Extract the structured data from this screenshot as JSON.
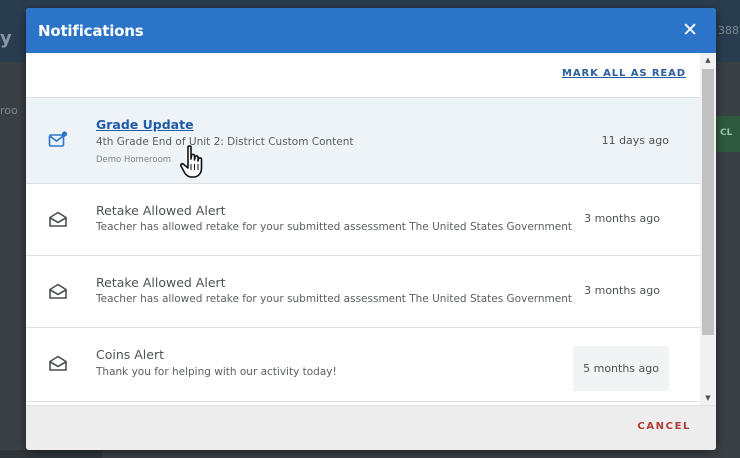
{
  "background": {
    "left_fragment": "y",
    "right_fragment": "388",
    "left_tab_fragment": "roo",
    "right_button_fragment": "CL"
  },
  "modal": {
    "title": "Notifications",
    "close_icon": "close-icon",
    "mark_all_label": "MARK ALL AS READ",
    "cancel_label": "CANCEL",
    "colors": {
      "header": "#2b74c7",
      "link": "#2b5e9c",
      "cancel": "#b23a32",
      "unread_bg": "#eef3f8"
    }
  },
  "notifications": [
    {
      "icon": "envelope-unread-icon",
      "title": "Grade Update",
      "message": "4th Grade End of Unit 2: District Custom Content",
      "subtitle": "Demo Homeroom",
      "time": "11 days ago",
      "unread": true
    },
    {
      "icon": "envelope-open-icon",
      "title": "Retake Allowed Alert",
      "message": "Teacher has allowed retake for your submitted assessment The United States Government",
      "time": "3 months ago",
      "unread": false
    },
    {
      "icon": "envelope-open-icon",
      "title": "Retake Allowed Alert",
      "message": "Teacher has allowed retake for your submitted assessment The United States Government",
      "time": "3 months ago",
      "unread": false
    },
    {
      "icon": "envelope-open-icon",
      "title": "Coins Alert",
      "message": "Thank you for helping with our activity today!",
      "time": "5 months ago",
      "unread": false
    }
  ]
}
